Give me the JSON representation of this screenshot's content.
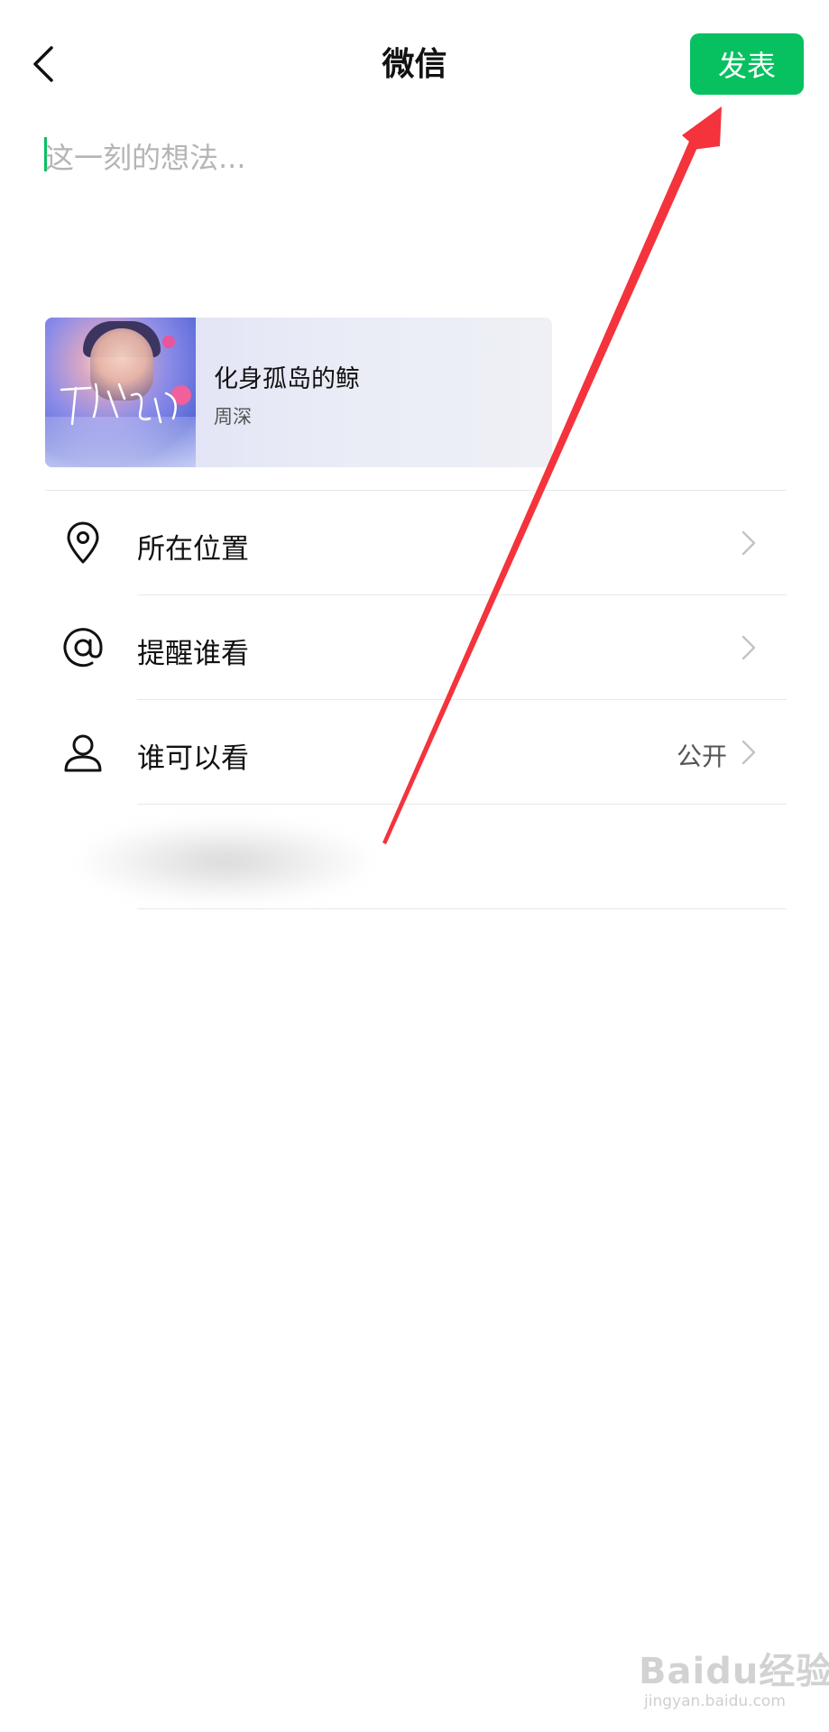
{
  "header": {
    "title": "微信",
    "publish_label": "发表"
  },
  "composer": {
    "placeholder": "这一刻的想法..."
  },
  "music": {
    "title": "化身孤岛的鲸",
    "artist": "周深",
    "cover_script": "化身孤岛的鲸"
  },
  "options": [
    {
      "label": "所在位置",
      "value": "",
      "icon": "location-pin-icon"
    },
    {
      "label": "提醒谁看",
      "value": "",
      "icon": "at-sign-icon"
    },
    {
      "label": "谁可以看",
      "value": "公开",
      "icon": "person-icon"
    }
  ],
  "watermark": {
    "logo": "Baidu经验",
    "sub": "jingyan.baidu.com"
  },
  "colors": {
    "accent": "#07c160",
    "annotation_arrow": "#f4333c",
    "divider": "#e8e8e8"
  }
}
